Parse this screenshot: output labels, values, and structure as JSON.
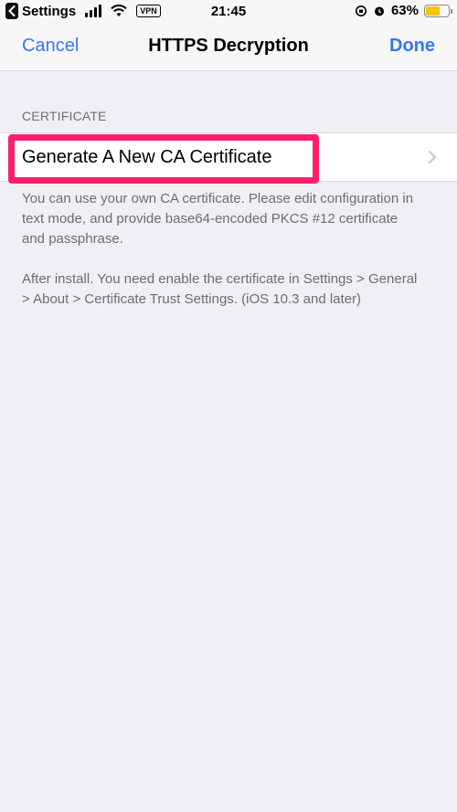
{
  "status_bar": {
    "back_app": "Settings",
    "vpn": "VPN",
    "time": "21:45",
    "battery_percent": "63%",
    "battery_level": 0.63
  },
  "nav": {
    "cancel": "Cancel",
    "title": "HTTPS Decryption",
    "done": "Done"
  },
  "section": {
    "header": "CERTIFICATE",
    "cell_label": "Generate A New CA Certificate",
    "footer_1": "You can use your own CA certificate. Please edit configuration in text mode, and provide base64-encoded PKCS #12 certificate and passphrase.",
    "footer_2": "After install. You need enable the certificate in Settings > General > About > Certificate Trust Settings. (iOS 10.3 and later)"
  },
  "colors": {
    "accent": "#3478f6",
    "highlight": "#ff1f6b",
    "battery": "#f6c300"
  }
}
